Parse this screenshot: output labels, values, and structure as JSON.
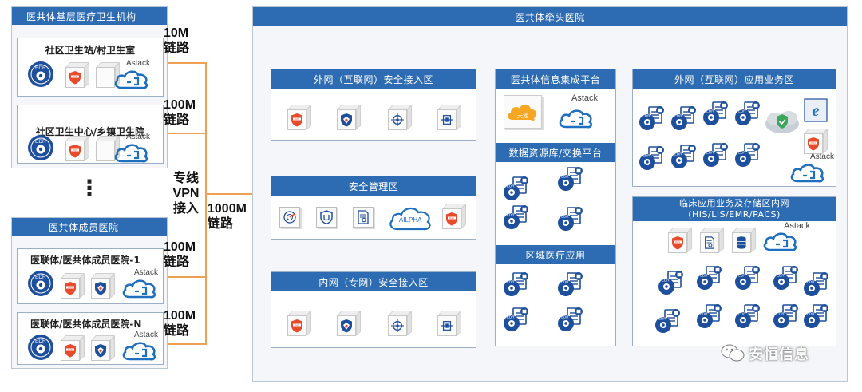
{
  "left": {
    "base_group": {
      "title": "医共体基层医疗卫生机构",
      "box1": {
        "title": "社区卫生站/村卫生室",
        "link": [
          "10M",
          "链路"
        ]
      },
      "box2": {
        "title": "社区卫生中心/乡镇卫生院",
        "link": [
          "100M",
          "链路"
        ]
      }
    },
    "ellipsis": "⋮",
    "member_group": {
      "title": "医共体成员医院",
      "box1": {
        "title": "医联体/医共体成员医院-1",
        "link": [
          "100M",
          "链路"
        ]
      },
      "box2": {
        "title": "医联体/医共体成员医院-N",
        "link": [
          "100M",
          "链路"
        ]
      }
    }
  },
  "vpn_label": [
    "专线",
    "VPN",
    "接入"
  ],
  "trunk_label": [
    "1000M",
    "链路"
  ],
  "main": {
    "title": "医共体牵头医院",
    "ext_access": {
      "title": "外网（互联网）安全接入区"
    },
    "sec_mgmt": {
      "title": "安全管理区",
      "ailpha": "AILPHA"
    },
    "int_access": {
      "title": "内网（专网）安全接入区"
    },
    "integration": {
      "title": "医共体信息集成平台",
      "cloud_text": "天池"
    },
    "data_exchange": {
      "title": "数据资源库/交换平台"
    },
    "regional": {
      "title": "区域医疗应用"
    },
    "ext_app": {
      "title": "外网（互联网）应用业务区"
    },
    "clinical": {
      "title": "临床应用业务及存储区内网",
      "subtitle": "(HIS/LIS/EMR/PACS)"
    }
  },
  "icons": {
    "edr": "EDR",
    "astack": "Astack"
  },
  "watermark": "安恒信息",
  "colors": {
    "header_blue": "#2d6bb3",
    "link_orange": "#f0a055",
    "panel_border": "#9bb0c6",
    "edr_blue": "#1e4f9c",
    "shield_red": "#e84b2b"
  }
}
